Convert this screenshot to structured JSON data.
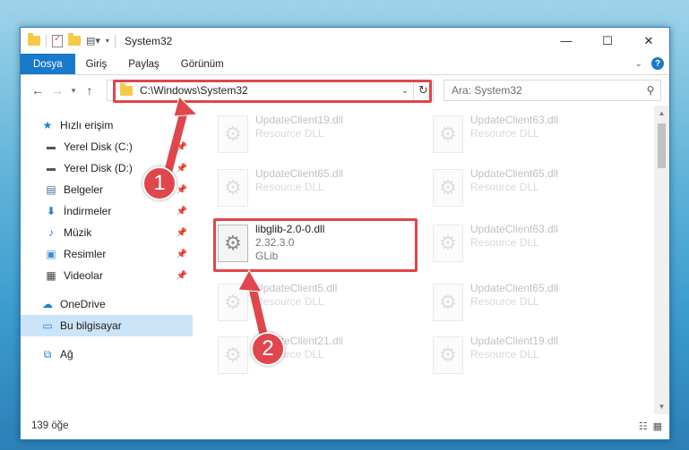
{
  "window": {
    "title": "System32",
    "controls": {
      "minimize": "—",
      "maximize": "☐",
      "close": "✕"
    }
  },
  "ribbon": {
    "tabs": [
      "Dosya",
      "Giriş",
      "Paylaş",
      "Görünüm"
    ],
    "help": "?"
  },
  "nav": {
    "address": "C:\\Windows\\System32",
    "search_placeholder": "Ara: System32"
  },
  "sidebar": {
    "quick_access": "Hızlı erişim",
    "pinned": [
      "Yerel Disk (C:)",
      "Yerel Disk (D:)",
      "Belgeler",
      "İndirmeler",
      "Müzik",
      "Resimler",
      "Videolar"
    ],
    "onedrive": "OneDrive",
    "this_pc": "Bu bilgisayar",
    "network": "Ağ"
  },
  "files": {
    "left": [
      {
        "name": "UpdateClient19.dll",
        "desc": "Resource DLL"
      },
      {
        "name": "UpdateClient65.dll",
        "desc": "Resource DLL"
      },
      {
        "name": "libglib-2.0-0.dll",
        "version": "2.32.3.0",
        "company": "GLib"
      },
      {
        "name": "UpdateClient5.dll",
        "desc": "Resource DLL"
      },
      {
        "name": "UpdateClient21.dll",
        "desc": "Resource DLL"
      }
    ],
    "right": [
      {
        "name": "UpdateClient63.dll",
        "desc": "Resource DLL"
      },
      {
        "name": "UpdateClient65.dll",
        "desc": "Resource DLL"
      },
      {
        "name": "UpdateClient63.dll",
        "desc": "Resource DLL"
      },
      {
        "name": "UpdateClient65.dll",
        "desc": "Resource DLL"
      },
      {
        "name": "UpdateClient19.dll",
        "desc": "Resource DLL"
      }
    ]
  },
  "status": {
    "count": "139 öğe"
  },
  "annotations": {
    "step1": "1",
    "step2": "2",
    "color": "#e0464b"
  }
}
